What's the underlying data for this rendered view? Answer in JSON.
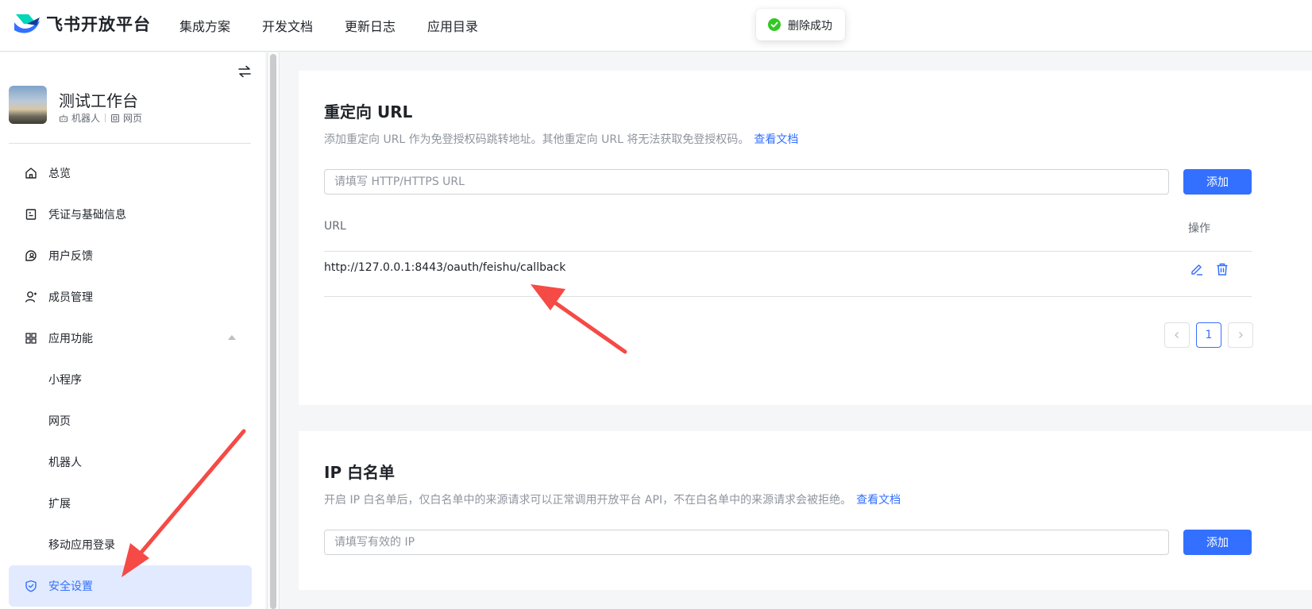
{
  "topbar": {
    "brand": "飞书开放平台",
    "nav": [
      "集成方案",
      "开发文档",
      "更新日志",
      "应用目录"
    ],
    "toast": "删除成功"
  },
  "sidebar": {
    "app_name": "测试工作台",
    "app_tags": [
      "机器人",
      "网页"
    ],
    "items": [
      {
        "label": "总览",
        "icon": "home-icon"
      },
      {
        "label": "凭证与基础信息",
        "icon": "credential-icon"
      },
      {
        "label": "用户反馈",
        "icon": "feedback-icon"
      },
      {
        "label": "成员管理",
        "icon": "user-icon"
      },
      {
        "label": "应用功能",
        "icon": "apps-grid-icon"
      },
      {
        "label": "小程序"
      },
      {
        "label": "网页"
      },
      {
        "label": "机器人"
      },
      {
        "label": "扩展"
      },
      {
        "label": "移动应用登录"
      },
      {
        "label": "安全设置",
        "icon": "shield-icon",
        "active": true
      }
    ]
  },
  "redirect": {
    "title": "重定向 URL",
    "desc": "添加重定向 URL 作为免登授权码跳转地址。其他重定向 URL 将无法获取免登授权码。",
    "doc_link": "查看文档",
    "input_placeholder": "请填写 HTTP/HTTPS URL",
    "add_label": "添加",
    "col_url": "URL",
    "col_action": "操作",
    "rows": [
      {
        "url": "http://127.0.0.1:8443/oauth/feishu/callback"
      }
    ],
    "page": "1"
  },
  "ip_whitelist": {
    "title": "IP 白名单",
    "desc": "开启 IP 白名单后，仅白名单中的来源请求可以正常调用开放平台 API，不在白名单中的来源请求会被拒绝。",
    "doc_link": "查看文档",
    "input_placeholder": "请填写有效的 IP",
    "add_label": "添加"
  },
  "colors": {
    "accent": "#3370ff",
    "active_bg": "#e1eaff",
    "success": "#34c724",
    "annotation": "#f54a45"
  }
}
